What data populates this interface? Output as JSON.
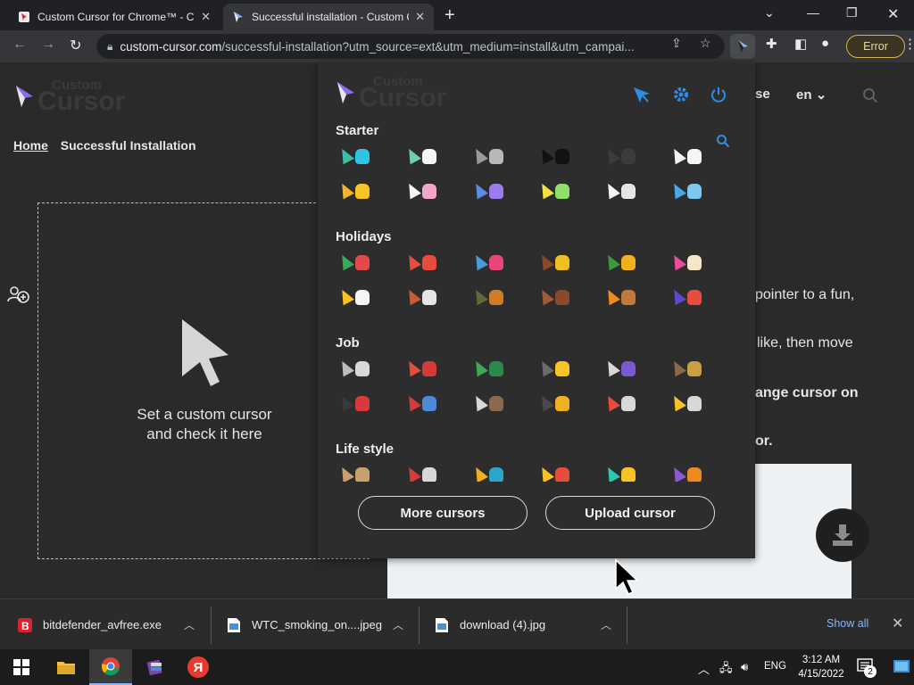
{
  "browser": {
    "tabs": [
      {
        "title": "Custom Cursor for Chrome™ - Chr",
        "active": false
      },
      {
        "title": "Successful installation - Custom C",
        "active": true
      }
    ],
    "address": {
      "host": "custom-cursor.com",
      "path": "/successful-installation?utm_source=ext&utm_medium=install&utm_campai..."
    },
    "error_label": "Error"
  },
  "page": {
    "logo": {
      "small": "Custom",
      "big": "Cursor"
    },
    "breadcrumb": {
      "home": "Home",
      "current": "Successful Installation"
    },
    "try_area_text": [
      "Set a custom cursor",
      "and check it here"
    ],
    "nav_partial": "se",
    "language": "en",
    "right_text": [
      {
        "text": "pointer to a fun,",
        "bold": false
      },
      {
        "text": "like, then move",
        "bold": false
      },
      {
        "text": "ange cursor on",
        "bold": true
      },
      {
        "text": "or.",
        "bold": true
      }
    ]
  },
  "popup": {
    "logo": {
      "small": "Custom",
      "big": "Cursor"
    },
    "header_icons": [
      "cursor-icon",
      "gear-icon",
      "power-icon"
    ],
    "categories": [
      {
        "name": "Starter",
        "rows": [
          [
            {
              "a": "#3dbfa6",
              "b": "#2ec4e6"
            },
            {
              "a": "#6fd0b0",
              "b": "#f5f5f5"
            },
            {
              "a": "#9b9b9b",
              "b": "#b8b8b8"
            },
            {
              "a": "#111111",
              "b": "#111111"
            },
            {
              "a": "#3b3b3b",
              "b": "#3b3b3b"
            },
            {
              "a": "#f5f5f5",
              "b": "#f5f5f5"
            }
          ],
          [
            {
              "a": "#f2b632",
              "b": "#f7c325"
            },
            {
              "a": "#f5f5f5",
              "b": "#f2a6c9"
            },
            {
              "a": "#5a8ce0",
              "b": "#9b7cf0"
            },
            {
              "a": "#f2e142",
              "b": "#8ee06a"
            },
            {
              "a": "#f5f5f5",
              "b": "#e6e6e6"
            },
            {
              "a": "#4aa6e6",
              "b": "#7cc8f0"
            }
          ]
        ]
      },
      {
        "name": "Holidays",
        "rows": [
          [
            {
              "a": "#3ca85a",
              "b": "#e24a4a"
            },
            {
              "a": "#e84c3d",
              "b": "#e84c3d"
            },
            {
              "a": "#4a9ad8",
              "b": "#e8477a"
            },
            {
              "a": "#8a4a2a",
              "b": "#f0c020"
            },
            {
              "a": "#3c9a3c",
              "b": "#f0b020"
            },
            {
              "a": "#e84c9a",
              "b": "#f5e6c8"
            }
          ],
          [
            {
              "a": "#f7c325",
              "b": "#f5f5f5"
            },
            {
              "a": "#c85a3a",
              "b": "#e6e6e6"
            },
            {
              "a": "#5a6a3a",
              "b": "#d07a2a"
            },
            {
              "a": "#a05a3a",
              "b": "#8a4a2a"
            },
            {
              "a": "#f08a20",
              "b": "#c07a3a"
            },
            {
              "a": "#5a4ad0",
              "b": "#e84c3d"
            }
          ]
        ]
      },
      {
        "name": "Job",
        "rows": [
          [
            {
              "a": "#bdbdbd",
              "b": "#d8d8d8"
            },
            {
              "a": "#e84c3d",
              "b": "#d83a3a"
            },
            {
              "a": "#3ca85a",
              "b": "#2a8a4a"
            },
            {
              "a": "#6a6a6a",
              "b": "#f7c325"
            },
            {
              "a": "#d8d8d8",
              "b": "#7a5ad0"
            },
            {
              "a": "#8a6a4a",
              "b": "#c8a040"
            }
          ],
          [
            {
              "a": "#3a3a3a",
              "b": "#d83a3a"
            },
            {
              "a": "#d83a3a",
              "b": "#4a8ad8"
            },
            {
              "a": "#d8d8d8",
              "b": "#8a6a4a"
            },
            {
              "a": "#4a4a4a",
              "b": "#f0b020"
            },
            {
              "a": "#e84c3d",
              "b": "#d8d8d8"
            },
            {
              "a": "#f7c325",
              "b": "#d8d8d8"
            }
          ]
        ]
      },
      {
        "name": "Life style",
        "rows": [
          [
            {
              "a": "#c8a070",
              "b": "#c8a070"
            },
            {
              "a": "#d83a3a",
              "b": "#d8d8d8"
            },
            {
              "a": "#f0b020",
              "b": "#2aa6c8"
            },
            {
              "a": "#f7c325",
              "b": "#e84c3d"
            },
            {
              "a": "#2ac8b0",
              "b": "#f7c325"
            },
            {
              "a": "#8a5ad0",
              "b": "#f08a20"
            }
          ]
        ]
      }
    ],
    "buttons": {
      "more": "More cursors",
      "upload": "Upload cursor"
    }
  },
  "downloads": [
    {
      "name": "bitdefender_avfree.exe",
      "icon": "bitdefender-icon",
      "color": "#d9232d"
    },
    {
      "name": "WTC_smoking_on....jpeg",
      "icon": "image-file-icon",
      "color": "#4a90d9"
    },
    {
      "name": "download (4).jpg",
      "icon": "image-file-icon",
      "color": "#4a90d9"
    }
  ],
  "shelf": {
    "show_all": "Show all"
  },
  "taskbar": {
    "apps": [
      "windows-start-icon",
      "file-explorer-icon",
      "chrome-icon",
      "winrar-icon",
      "yandex-icon"
    ],
    "yandex_letter": "Я",
    "lang": "ENG",
    "time": "3:12 AM",
    "date": "4/15/2022",
    "notifications": "2"
  },
  "colors": {
    "accent_blue": "#2e8ee6",
    "page_bg": "#2a2a2a",
    "popup_bg": "#2d2d2d"
  }
}
